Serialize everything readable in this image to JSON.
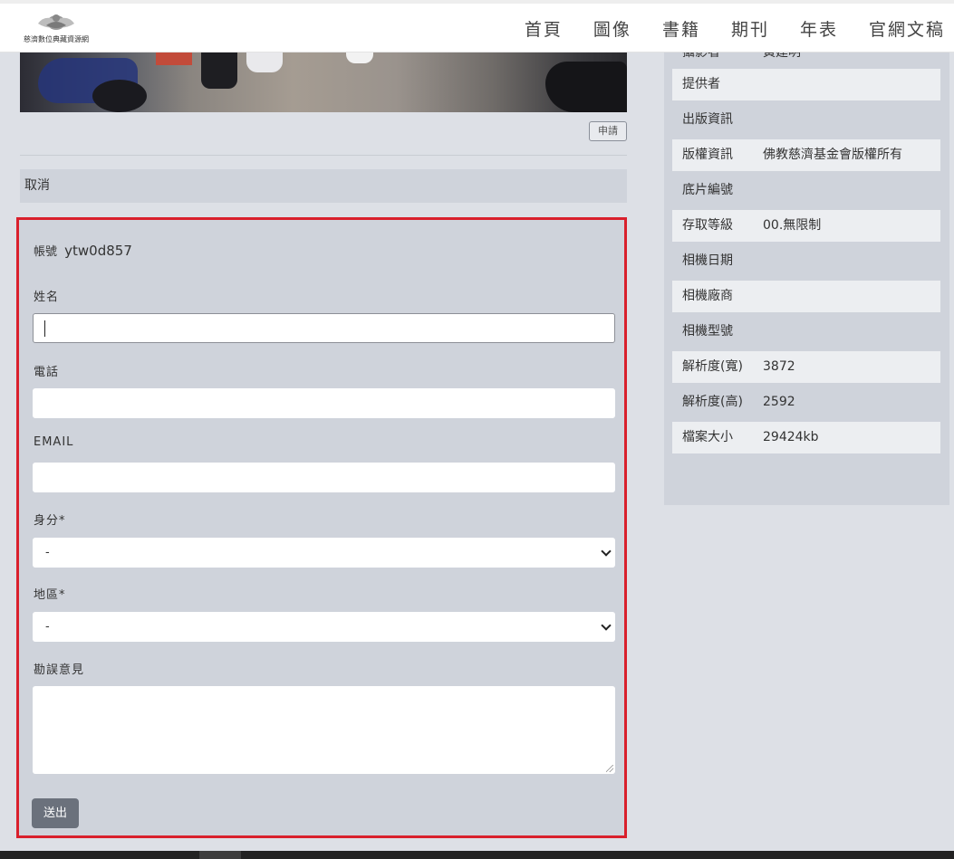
{
  "header": {
    "logo_text": "慈濟數位典藏資源網",
    "nav": [
      "首頁",
      "圖像",
      "書籍",
      "期刊",
      "年表",
      "官網文稿"
    ]
  },
  "photo_actions": {
    "apply_label": "申請"
  },
  "cancel_label": "取消",
  "form": {
    "account_label": "帳號",
    "account_value": "ytw0d857",
    "name_label": "姓名",
    "phone_label": "電話",
    "email_label": "EMAIL",
    "identity_label": "身分*",
    "identity_selected": "-",
    "region_label": "地區*",
    "region_selected": "-",
    "comment_label": "勘誤意見",
    "submit_label": "送出"
  },
  "metadata": [
    {
      "key": "攝影者",
      "value": "黃建明"
    },
    {
      "key": "提供者",
      "value": ""
    },
    {
      "key": "出版資訊",
      "value": ""
    },
    {
      "key": "版權資訊",
      "value": "佛教慈濟基金會版權所有"
    },
    {
      "key": "底片編號",
      "value": ""
    },
    {
      "key": "存取等級",
      "value": "00.無限制"
    },
    {
      "key": "相機日期",
      "value": ""
    },
    {
      "key": "相機廠商",
      "value": ""
    },
    {
      "key": "相機型號",
      "value": ""
    },
    {
      "key": "解析度(寬)",
      "value": "3872"
    },
    {
      "key": "解析度(高)",
      "value": "2592"
    },
    {
      "key": "檔案大小",
      "value": "29424kb"
    }
  ]
}
